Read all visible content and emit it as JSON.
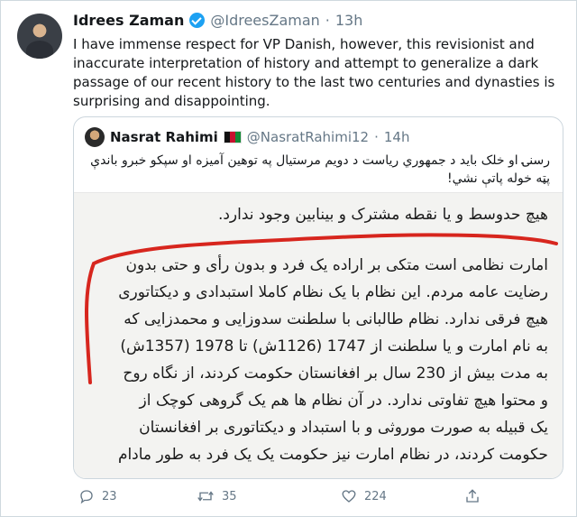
{
  "tweet": {
    "author_name": "Idrees Zaman",
    "handle": "@IdreesZaman",
    "separator": "·",
    "time": "13h",
    "text": "I have immense respect for VP Danish, however, this revisionist and inaccurate interpretation of history and attempt to generalize a dark passage of our recent history to the last two centuries and dynasties is surprising and disappointing."
  },
  "quoted": {
    "author_name": "Nasrat Rahimi",
    "handle": "@NasratRahimi12",
    "separator": "·",
    "time": "14h",
    "text": "رسنۍ او خلک باید د جمهوري ریاست د دویم مرستیال په توهین آمیزه او سپکو خبرو باندې پټه خوله پاتې نشي!",
    "image_lines": [
      "هیچ حدوسط و یا نقطه مشترک و بینابین وجود ندارد.",
      "امارت نظامی است متکی بر اراده یک فرد و بدون رأی و حتی بدون",
      "رضایت عامه مردم. این نظام با یک نظام کاملا استبدادی و دیکتاتوری",
      "هیچ فرقی ندارد. نظام طالبانی با سلطنت سدوزایی و محمدزایی که",
      "به نام امارت و یا سلطنت از 1747 (1126ش) تا 1978 (1357ش)",
      "به مدت بیش از 230 سال بر افغانستان حکومت کردند، از نگاه روح",
      "و محتوا هیچ تفاوتی ندارد. در آن نظام ها هم یک گروهی کوچک از",
      "یک قبیله به صورت موروثی و با استبداد و دیکتاتوری بر افغانستان",
      "حکومت کردند، در نظام امارت نیز حکومت یک یک فرد به طور مادام"
    ]
  },
  "actions": {
    "reply_count": "23",
    "retweet_count": "35",
    "like_count": "224"
  },
  "colors": {
    "verified": "#1da1f2",
    "muted": "#657786",
    "annotation_red": "#d7261e"
  }
}
